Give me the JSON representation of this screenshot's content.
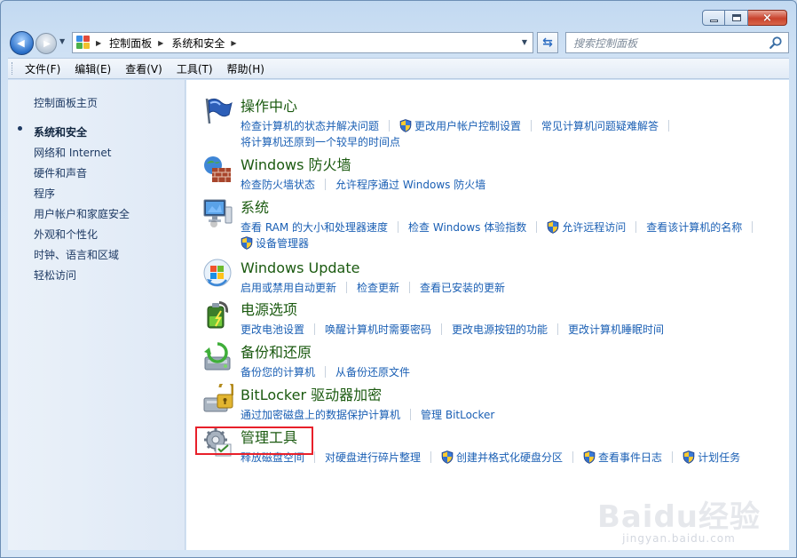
{
  "window": {
    "minimize_label": "",
    "close_glyph": "×"
  },
  "nav": {
    "back_glyph": "◀",
    "forward_glyph": "▶",
    "breadcrumbs": [
      "控制面板",
      "系统和安全"
    ],
    "search_placeholder": "搜索控制面板"
  },
  "menu": [
    "文件(F)",
    "编辑(E)",
    "查看(V)",
    "工具(T)",
    "帮助(H)"
  ],
  "sidebar": {
    "home": "控制面板主页",
    "items": [
      "系统和安全",
      "网络和 Internet",
      "硬件和声音",
      "程序",
      "用户帐户和家庭安全",
      "外观和个性化",
      "时钟、语言和区域",
      "轻松访问"
    ],
    "active_index": 0
  },
  "categories": [
    {
      "title": "操作中心",
      "icon": "flag-icon",
      "link_rows": [
        [
          {
            "text": "检查计算机的状态并解决问题",
            "shield": false
          },
          {
            "text": "更改用户帐户控制设置",
            "shield": true
          },
          {
            "text": "常见计算机问题疑难解答",
            "shield": false
          }
        ],
        [
          {
            "text": "将计算机还原到一个较早的时间点",
            "shield": false
          }
        ]
      ]
    },
    {
      "title": "Windows 防火墙",
      "icon": "firewall-icon",
      "link_rows": [
        [
          {
            "text": "检查防火墙状态",
            "shield": false
          },
          {
            "text": "允许程序通过 Windows 防火墙",
            "shield": false
          }
        ]
      ]
    },
    {
      "title": "系统",
      "icon": "computer-icon",
      "link_rows": [
        [
          {
            "text": "查看 RAM 的大小和处理器速度",
            "shield": false
          },
          {
            "text": "检查 Windows 体验指数",
            "shield": false
          },
          {
            "text": "允许远程访问",
            "shield": true
          },
          {
            "text": "查看该计算机的名称",
            "shield": false
          }
        ],
        [
          {
            "text": "设备管理器",
            "shield": true
          }
        ]
      ]
    },
    {
      "title": "Windows Update",
      "icon": "windows-update-icon",
      "link_rows": [
        [
          {
            "text": "启用或禁用自动更新",
            "shield": false
          },
          {
            "text": "检查更新",
            "shield": false
          },
          {
            "text": "查看已安装的更新",
            "shield": false
          }
        ]
      ]
    },
    {
      "title": "电源选项",
      "icon": "battery-icon",
      "link_rows": [
        [
          {
            "text": "更改电池设置",
            "shield": false
          },
          {
            "text": "唤醒计算机时需要密码",
            "shield": false
          },
          {
            "text": "更改电源按钮的功能",
            "shield": false
          },
          {
            "text": "更改计算机睡眠时间",
            "shield": false
          }
        ]
      ]
    },
    {
      "title": "备份和还原",
      "icon": "backup-icon",
      "link_rows": [
        [
          {
            "text": "备份您的计算机",
            "shield": false
          },
          {
            "text": "从备份还原文件",
            "shield": false
          }
        ]
      ]
    },
    {
      "title": "BitLocker 驱动器加密",
      "icon": "bitlocker-icon",
      "link_rows": [
        [
          {
            "text": "通过加密磁盘上的数据保护计算机",
            "shield": false
          },
          {
            "text": "管理 BitLocker",
            "shield": false
          }
        ]
      ]
    },
    {
      "title": "管理工具",
      "icon": "admin-tools-icon",
      "link_rows": [
        [
          {
            "text": "释放磁盘空间",
            "shield": false
          },
          {
            "text": "对硬盘进行碎片整理",
            "shield": false
          },
          {
            "text": "创建并格式化硬盘分区",
            "shield": true
          },
          {
            "text": "查看事件日志",
            "shield": true
          },
          {
            "text": "计划任务",
            "shield": true
          }
        ]
      ]
    }
  ],
  "watermark": {
    "main": "Baidu经验",
    "sub": "jingyan.baidu.com"
  },
  "colors": {
    "link": "#1a5fb4",
    "category_title": "#1b5a10",
    "highlight": "#e8202a"
  }
}
